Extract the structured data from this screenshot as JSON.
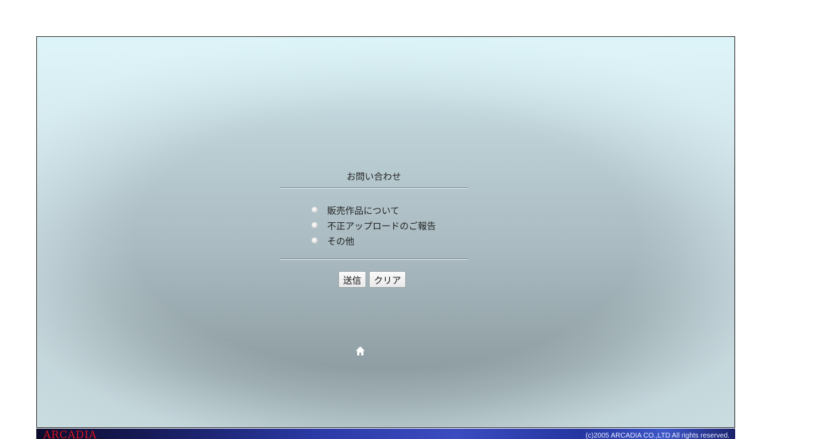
{
  "form": {
    "title": "お問い合わせ",
    "options": [
      {
        "label": "販売作品について",
        "selected": false
      },
      {
        "label": "不正アップロードのご報告",
        "selected": false
      },
      {
        "label": "その他",
        "selected": false
      }
    ],
    "submit_label": "送信",
    "clear_label": "クリア"
  },
  "nav": {
    "home_icon": "home-icon"
  },
  "footer": {
    "logo_text": "ARCADIA",
    "copyright": "(c)2005 ARCADIA CO.,LTD All rights reserved.",
    "logo_color": "#d8141e"
  }
}
